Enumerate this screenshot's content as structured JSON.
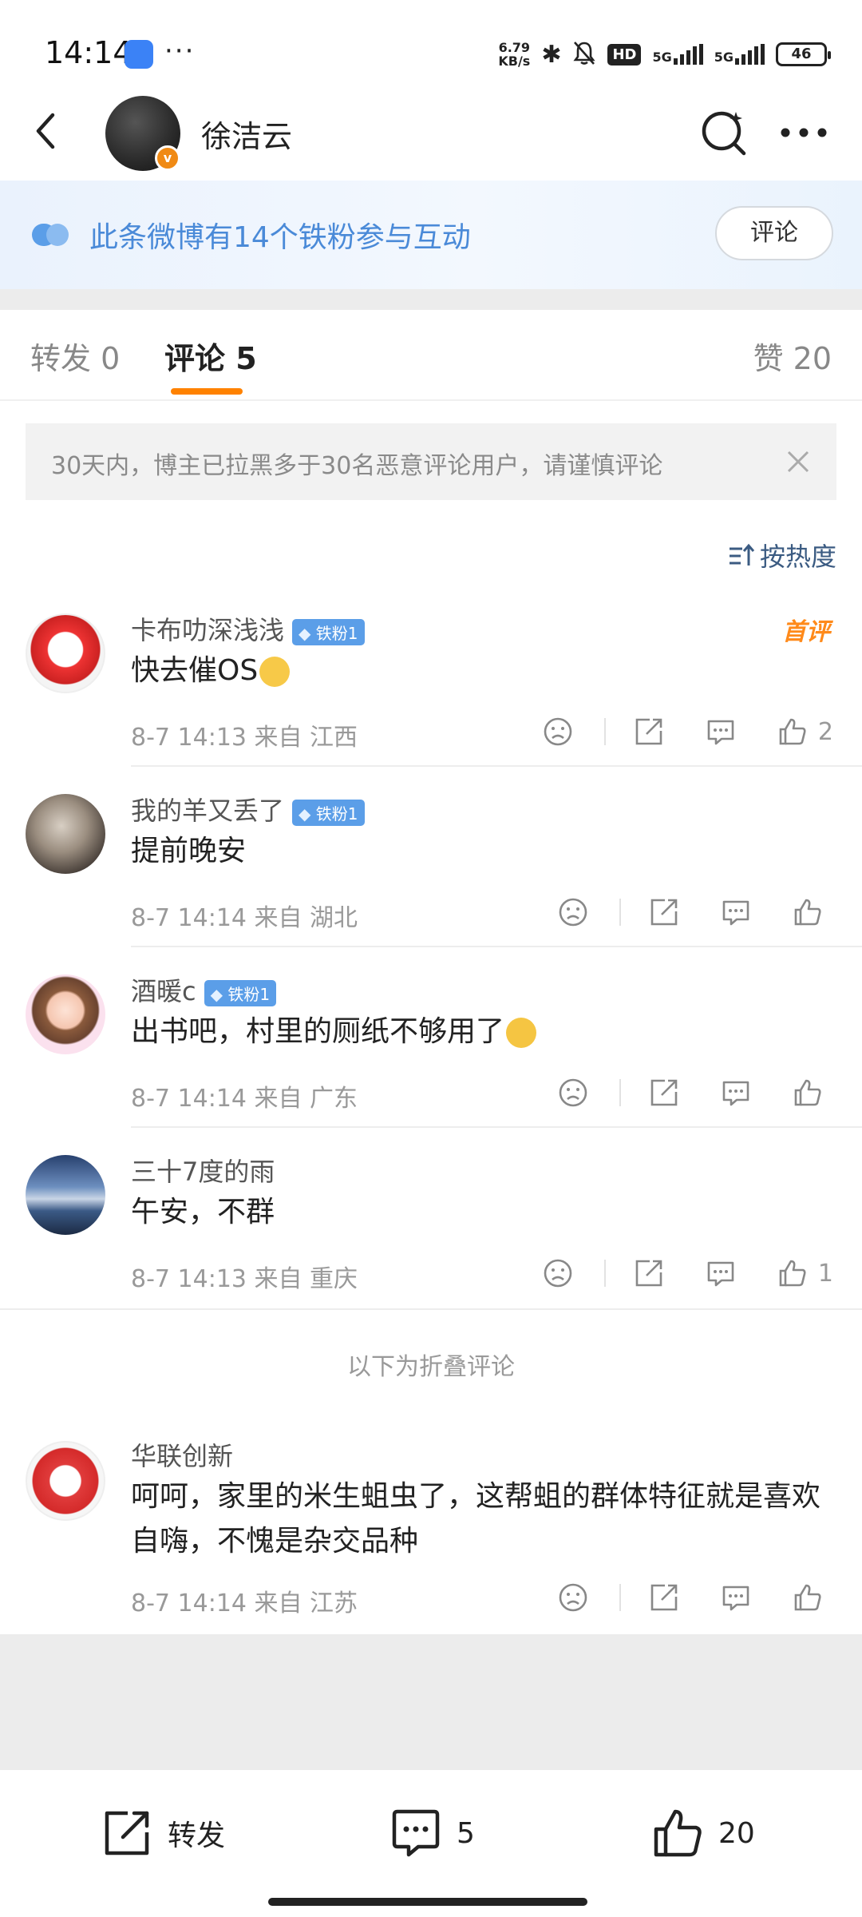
{
  "status_bar": {
    "time": "14:14",
    "speed_value": "6.79",
    "speed_unit": "KB/s",
    "hd_label": "HD",
    "net1": "5G",
    "net2": "5G",
    "battery": "46"
  },
  "header": {
    "title": "徐洁云"
  },
  "fan_banner": {
    "text": "此条微博有14个铁粉参与互动",
    "button": "评论"
  },
  "tabs": {
    "repost": "转发 0",
    "comments": "评论 5",
    "likes": "赞 20"
  },
  "notice": {
    "text": "30天内，博主已拉黑多于30名恶意评论用户，请谨慎评论"
  },
  "sort": {
    "label": "按热度"
  },
  "top_badge": "首评",
  "comments": [
    {
      "name": "卡布叻深浅浅",
      "badge": "铁粉1",
      "text": "快去催OS",
      "meta": "8-7 14:13  来自 江西",
      "likes": "2"
    },
    {
      "name": "我的羊又丢了",
      "badge": "铁粉1",
      "text": "提前晚安",
      "meta": "8-7 14:14  来自 湖北",
      "likes": ""
    },
    {
      "name": "酒暖c",
      "badge": "铁粉1",
      "text": "出书吧，村里的厕纸不够用了",
      "meta": "8-7 14:14  来自 广东",
      "likes": ""
    },
    {
      "name": "三十7度的雨",
      "badge": "",
      "text": "午安，不群",
      "meta": "8-7 14:13  来自 重庆",
      "likes": "1"
    },
    {
      "name": "华联创新",
      "badge": "",
      "text": "呵呵，家里的米生蛆虫了，这帮蛆的群体特征就是喜欢自嗨，不愧是杂交品种",
      "meta": "8-7 14:14  来自 江苏",
      "likes": ""
    }
  ],
  "folded_label": "以下为折叠评论",
  "bottom_bar": {
    "repost": "转发",
    "comment_count": "5",
    "like_count": "20"
  }
}
